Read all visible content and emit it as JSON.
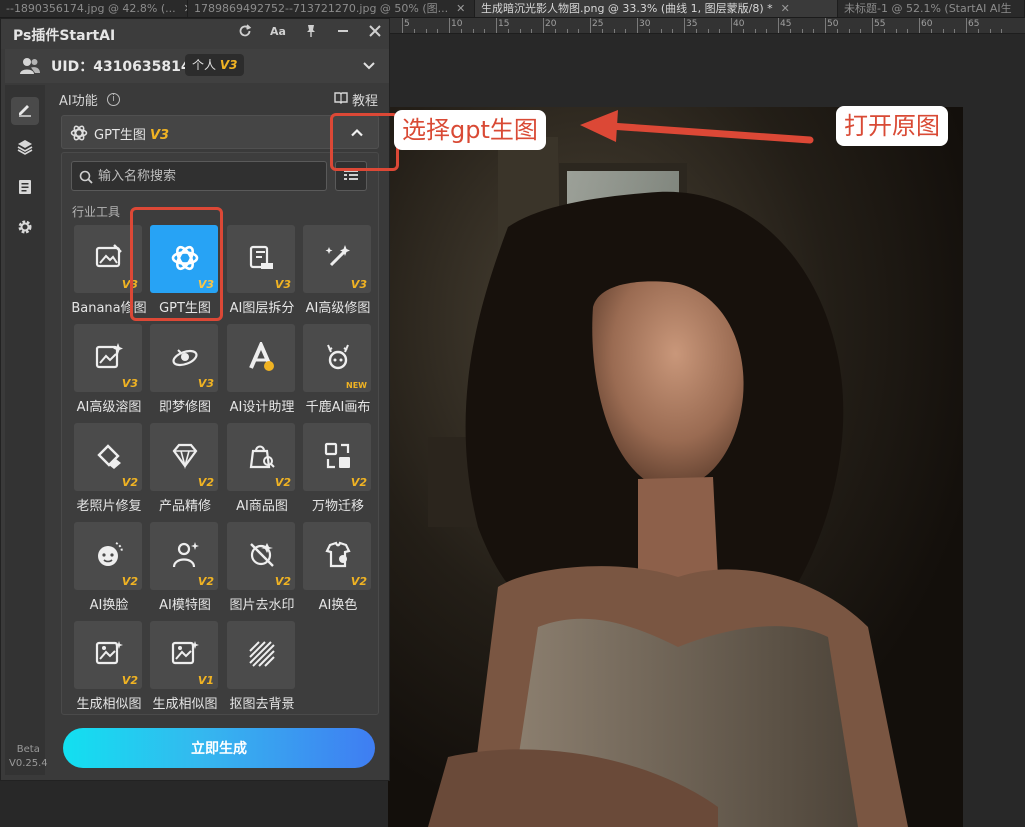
{
  "tabs": [
    {
      "label": "--1890356174.jpg @ 42.8% (...",
      "close": "✕"
    },
    {
      "label": "1789869492752--713721270.jpg @ 50% (图...",
      "close": "✕"
    },
    {
      "label": "生成暗沉光影人物图.png @ 33.3% (曲线 1, 图层蒙版/8) *",
      "close": "✕"
    },
    {
      "label": "未标题-1 @ 52.1% (StartAI AI生",
      "close": ""
    }
  ],
  "ruler": [
    "5",
    "10",
    "15",
    "20",
    "25",
    "30",
    "35",
    "40",
    "45",
    "50",
    "55",
    "60",
    "65"
  ],
  "panel": {
    "title": "Ps插件StartAI",
    "uid": "UID：4310635814",
    "plan": "个人",
    "plan_version": "V3",
    "section": "AI功能",
    "info_glyph": "i",
    "tutorial": "教程",
    "dropdown_label": "GPT生图",
    "dropdown_version": "V3",
    "search_placeholder": "输入名称搜索",
    "group_label": "行业工具",
    "beta_line1": "Beta",
    "beta_line2": "V0.25.4",
    "generate": "立即生成"
  },
  "tools": [
    {
      "name": "Banana修图",
      "version": "V3",
      "icon": "image-edit-icon",
      "selected": false
    },
    {
      "name": "GPT生图",
      "version": "V3",
      "icon": "gpt-logo-icon",
      "selected": true
    },
    {
      "name": "AI图层拆分",
      "version": "V3",
      "icon": "layer-split-icon",
      "selected": false
    },
    {
      "name": "AI高级修图",
      "version": "V3",
      "icon": "magic-wand-icon",
      "selected": false
    },
    {
      "name": "AI高级溶图",
      "version": "V3",
      "icon": "image-sparkle-icon",
      "selected": false
    },
    {
      "name": "即梦修图",
      "version": "V3",
      "icon": "dream-icon",
      "selected": false
    },
    {
      "name": "AI设计助理",
      "version": "",
      "icon": "design-assistant-icon",
      "selected": false
    },
    {
      "name": "千鹿AI画布",
      "version": "NEW",
      "icon": "deer-icon",
      "selected": false
    },
    {
      "name": "老照片修复",
      "version": "V2",
      "icon": "photo-repair-icon",
      "selected": false
    },
    {
      "name": "产品精修",
      "version": "V2",
      "icon": "diamond-icon",
      "selected": false
    },
    {
      "name": "AI商品图",
      "version": "V2",
      "icon": "product-bag-icon",
      "selected": false
    },
    {
      "name": "万物迁移",
      "version": "V2",
      "icon": "transfer-icon",
      "selected": false
    },
    {
      "name": "AI换脸",
      "version": "V2",
      "icon": "face-swap-icon",
      "selected": false
    },
    {
      "name": "AI模特图",
      "version": "V2",
      "icon": "model-icon",
      "selected": false
    },
    {
      "name": "图片去水印",
      "version": "V2",
      "icon": "watermark-remove-icon",
      "selected": false
    },
    {
      "name": "AI换色",
      "version": "V2",
      "icon": "recolor-icon",
      "selected": false
    },
    {
      "name": "生成相似图",
      "version": "V2",
      "icon": "similar-image-icon",
      "selected": false
    },
    {
      "name": "生成相似图",
      "version": "V1",
      "icon": "similar-image-icon",
      "selected": false
    },
    {
      "name": "抠图去背景",
      "version": "",
      "icon": "cutout-icon",
      "selected": false
    }
  ],
  "annotations": {
    "select_gpt": "选择gpt生图",
    "open_original": "打开原图"
  },
  "colors": {
    "accent_blue": "#27a3f5",
    "version_gold": "#f0b323",
    "annotation_red": "#dc4836"
  }
}
